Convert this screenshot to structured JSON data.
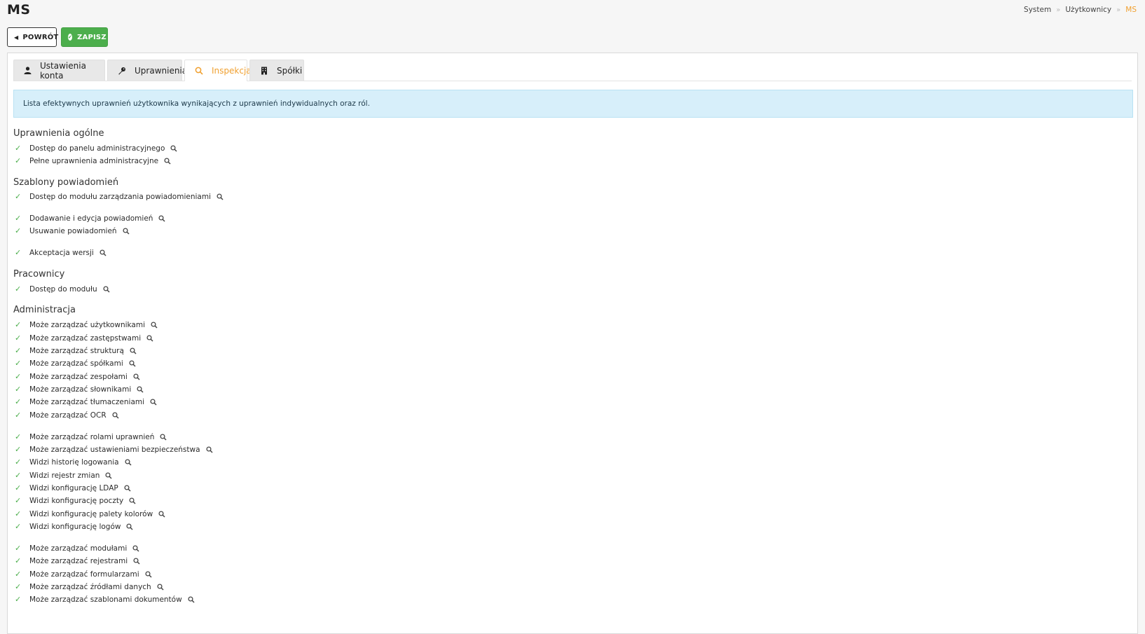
{
  "header": {
    "title": "MS",
    "breadcrumb": [
      "System",
      "Użytkownicy",
      "MS"
    ]
  },
  "toolbar": {
    "back_label": "POWRÓT",
    "save_label": "ZAPISZ"
  },
  "tabs": [
    {
      "label": "Ustawienia konta",
      "icon": "user-icon"
    },
    {
      "label": "Uprawnienia",
      "icon": "key-icon"
    },
    {
      "label": "Inspekcja",
      "icon": "search-icon",
      "active": true
    },
    {
      "label": "Spółki",
      "icon": "building-icon"
    }
  ],
  "alert": {
    "text": "Lista efektywnych uprawnień użytkownika wynikających z uprawnień indywidualnych oraz ról."
  },
  "sections": [
    {
      "title": "Uprawnienia ogólne",
      "items": [
        "Dostęp do panelu administracyjnego",
        "Pełne uprawnienia administracyjne"
      ]
    },
    {
      "title": "Szablony powiadomień",
      "items": [
        "Dostęp do modułu zarządzania powiadomieniami",
        "Dodawanie i edycja powiadomień",
        "Usuwanie powiadomień",
        "Akceptacja wersji"
      ]
    },
    {
      "title": "Pracownicy",
      "items": [
        "Dostęp do modułu"
      ]
    },
    {
      "title": "Administracja",
      "items": [
        "Może zarządzać użytkownikami",
        "Może zarządzać zastępstwami",
        "Może zarządzać strukturą",
        "Może zarządzać spółkami",
        "Może zarządzać zespołami",
        "Może zarządzać słownikami",
        "Może zarządzać tłumaczeniami",
        "Może zarządzać OCR",
        "Może zarządzać rolami uprawnień",
        "Może zarządzać ustawieniami bezpieczeństwa",
        "Widzi historię logowania",
        "Widzi rejestr zmian",
        "Widzi konfigurację LDAP",
        "Widzi konfigurację poczty",
        "Widzi konfigurację palety kolorów",
        "Widzi konfigurację logów",
        "Może zarządzać modułami",
        "Może zarządzać rejestrami",
        "Może zarządzać formularzami",
        "Może zarządzać źródłami danych",
        "Może zarządzać szablonami dokumentów"
      ]
    }
  ],
  "colors": {
    "accent": "#f0a030",
    "success": "#4cae4c",
    "info_bg": "#d7effa"
  }
}
